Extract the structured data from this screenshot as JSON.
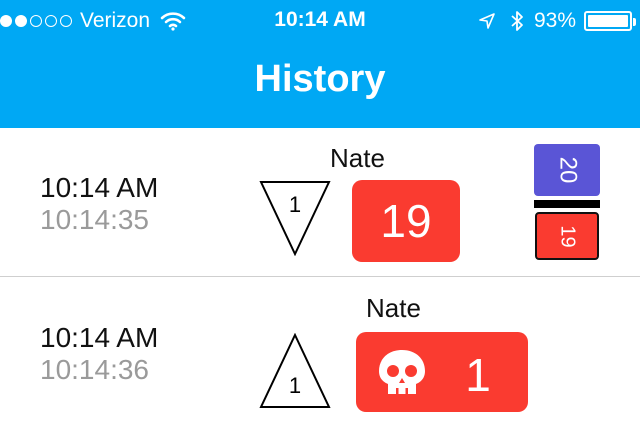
{
  "status_bar": {
    "signal_dots_filled": 2,
    "signal_dots_total": 5,
    "carrier": "Verizon",
    "time": "10:14 AM",
    "battery_percent": "93%"
  },
  "header": {
    "title": "History"
  },
  "entries": [
    {
      "time": "10:14 AM",
      "time_seconds": "10:14:35",
      "player": "Nate",
      "triangle": {
        "direction": "down",
        "value": "1"
      },
      "score": "19",
      "mini_top": "20",
      "mini_bottom": "19"
    },
    {
      "time": "10:14 AM",
      "time_seconds": "10:14:36",
      "player": "Nate",
      "triangle": {
        "direction": "up",
        "value": "1"
      },
      "score": "1",
      "icon": "skull-icon"
    }
  ],
  "colors": {
    "header_bg": "#00a8f4",
    "score_red": "#fa3b30",
    "mini_purple": "#5a55d6",
    "divider": "#cfcfcf",
    "seconds_gray": "#9a9a9a"
  }
}
